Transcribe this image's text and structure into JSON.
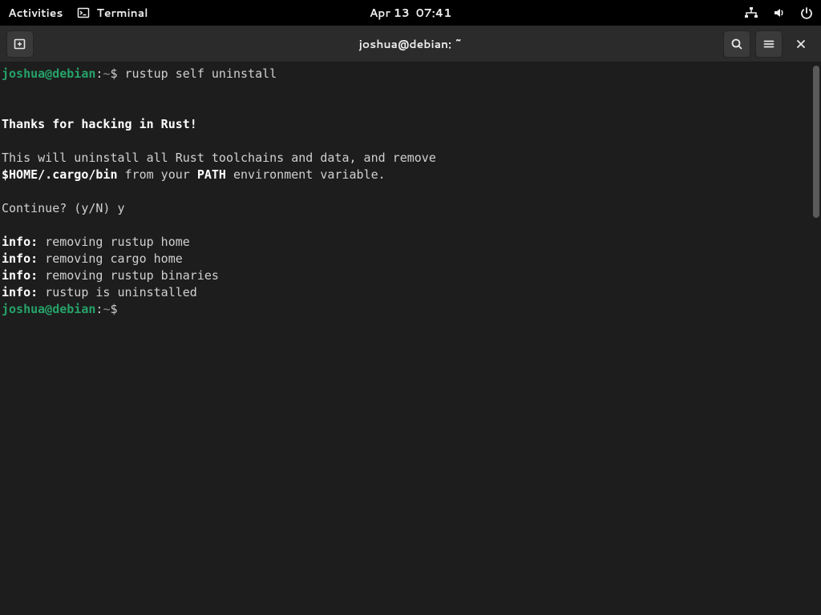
{
  "topbar": {
    "activities": "Activities",
    "app_name": "Terminal",
    "date": "Apr 13",
    "time": "07:41"
  },
  "headerbar": {
    "title": "joshua@debian: ~"
  },
  "prompt": {
    "user_host": "joshua@debian",
    "colon": ":",
    "cwd": "~",
    "symbol": "$"
  },
  "session": {
    "command": "rustup self uninstall",
    "thanks": "Thanks for hacking in Rust!",
    "desc_line": "This will uninstall all Rust toolchains and data, and remove",
    "cargo_bin": "$HOME/.cargo/bin",
    "from_your": " from your ",
    "path_word": "PATH",
    "env_tail": " environment variable.",
    "continue": "Continue? (y/N) y",
    "info_prefix": "info:",
    "info_1": " removing rustup home",
    "info_2": " removing cargo home",
    "info_3": " removing rustup binaries",
    "info_4": " rustup is uninstalled"
  }
}
